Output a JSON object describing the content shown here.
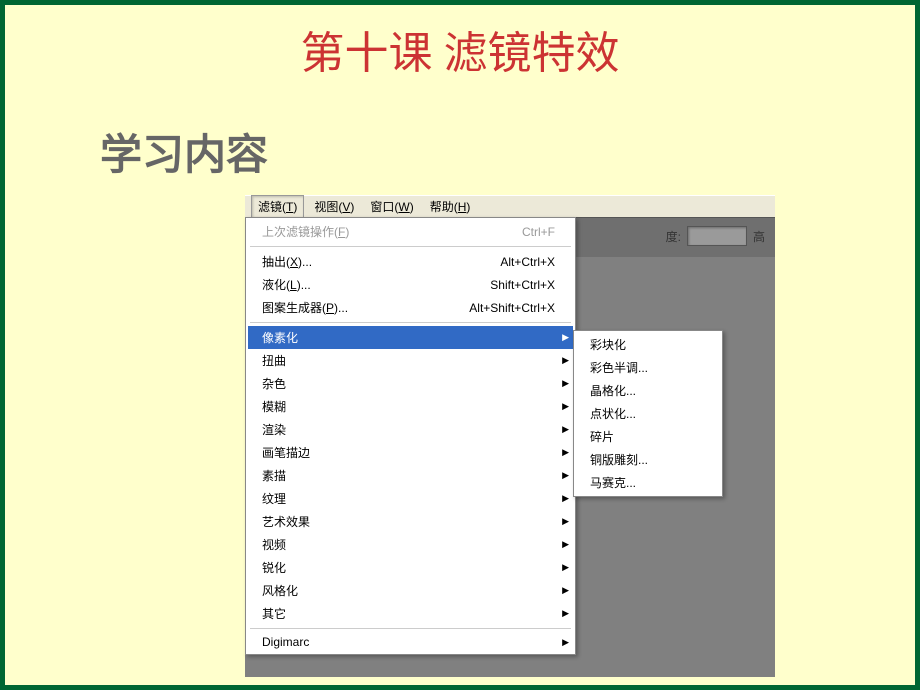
{
  "slide": {
    "title": "第十课 滤镜特效",
    "section_heading": "学习内容"
  },
  "menubar": {
    "items": [
      {
        "label": "滤镜",
        "key": "T"
      },
      {
        "label": "视图",
        "key": "V"
      },
      {
        "label": "窗口",
        "key": "W"
      },
      {
        "label": "帮助",
        "key": "H"
      }
    ]
  },
  "toolbar": {
    "label1": "度:",
    "label2": "高"
  },
  "filter_menu": {
    "group1": [
      {
        "label": "上次滤镜操作",
        "key": "F",
        "shortcut": "Ctrl+F",
        "disabled": true
      }
    ],
    "group2": [
      {
        "label": "抽出",
        "key": "X",
        "suffix": "...",
        "shortcut": "Alt+Ctrl+X"
      },
      {
        "label": "液化",
        "key": "L",
        "suffix": "...",
        "shortcut": "Shift+Ctrl+X"
      },
      {
        "label": "图案生成器",
        "key": "P",
        "suffix": "...",
        "shortcut": "Alt+Shift+Ctrl+X"
      }
    ],
    "group3": [
      {
        "label": "像素化",
        "submenu": true,
        "highlighted": true
      },
      {
        "label": "扭曲",
        "submenu": true
      },
      {
        "label": "杂色",
        "submenu": true
      },
      {
        "label": "模糊",
        "submenu": true
      },
      {
        "label": "渲染",
        "submenu": true
      },
      {
        "label": "画笔描边",
        "submenu": true
      },
      {
        "label": "素描",
        "submenu": true
      },
      {
        "label": "纹理",
        "submenu": true
      },
      {
        "label": "艺术效果",
        "submenu": true
      },
      {
        "label": "视频",
        "submenu": true
      },
      {
        "label": "锐化",
        "submenu": true
      },
      {
        "label": "风格化",
        "submenu": true
      },
      {
        "label": "其它",
        "submenu": true
      }
    ],
    "group4": [
      {
        "label": "Digimarc",
        "submenu": true
      }
    ]
  },
  "submenu": {
    "items": [
      {
        "label": "彩块化"
      },
      {
        "label": "彩色半调..."
      },
      {
        "label": "晶格化..."
      },
      {
        "label": "点状化..."
      },
      {
        "label": "碎片"
      },
      {
        "label": "铜版雕刻..."
      },
      {
        "label": "马赛克..."
      }
    ]
  }
}
